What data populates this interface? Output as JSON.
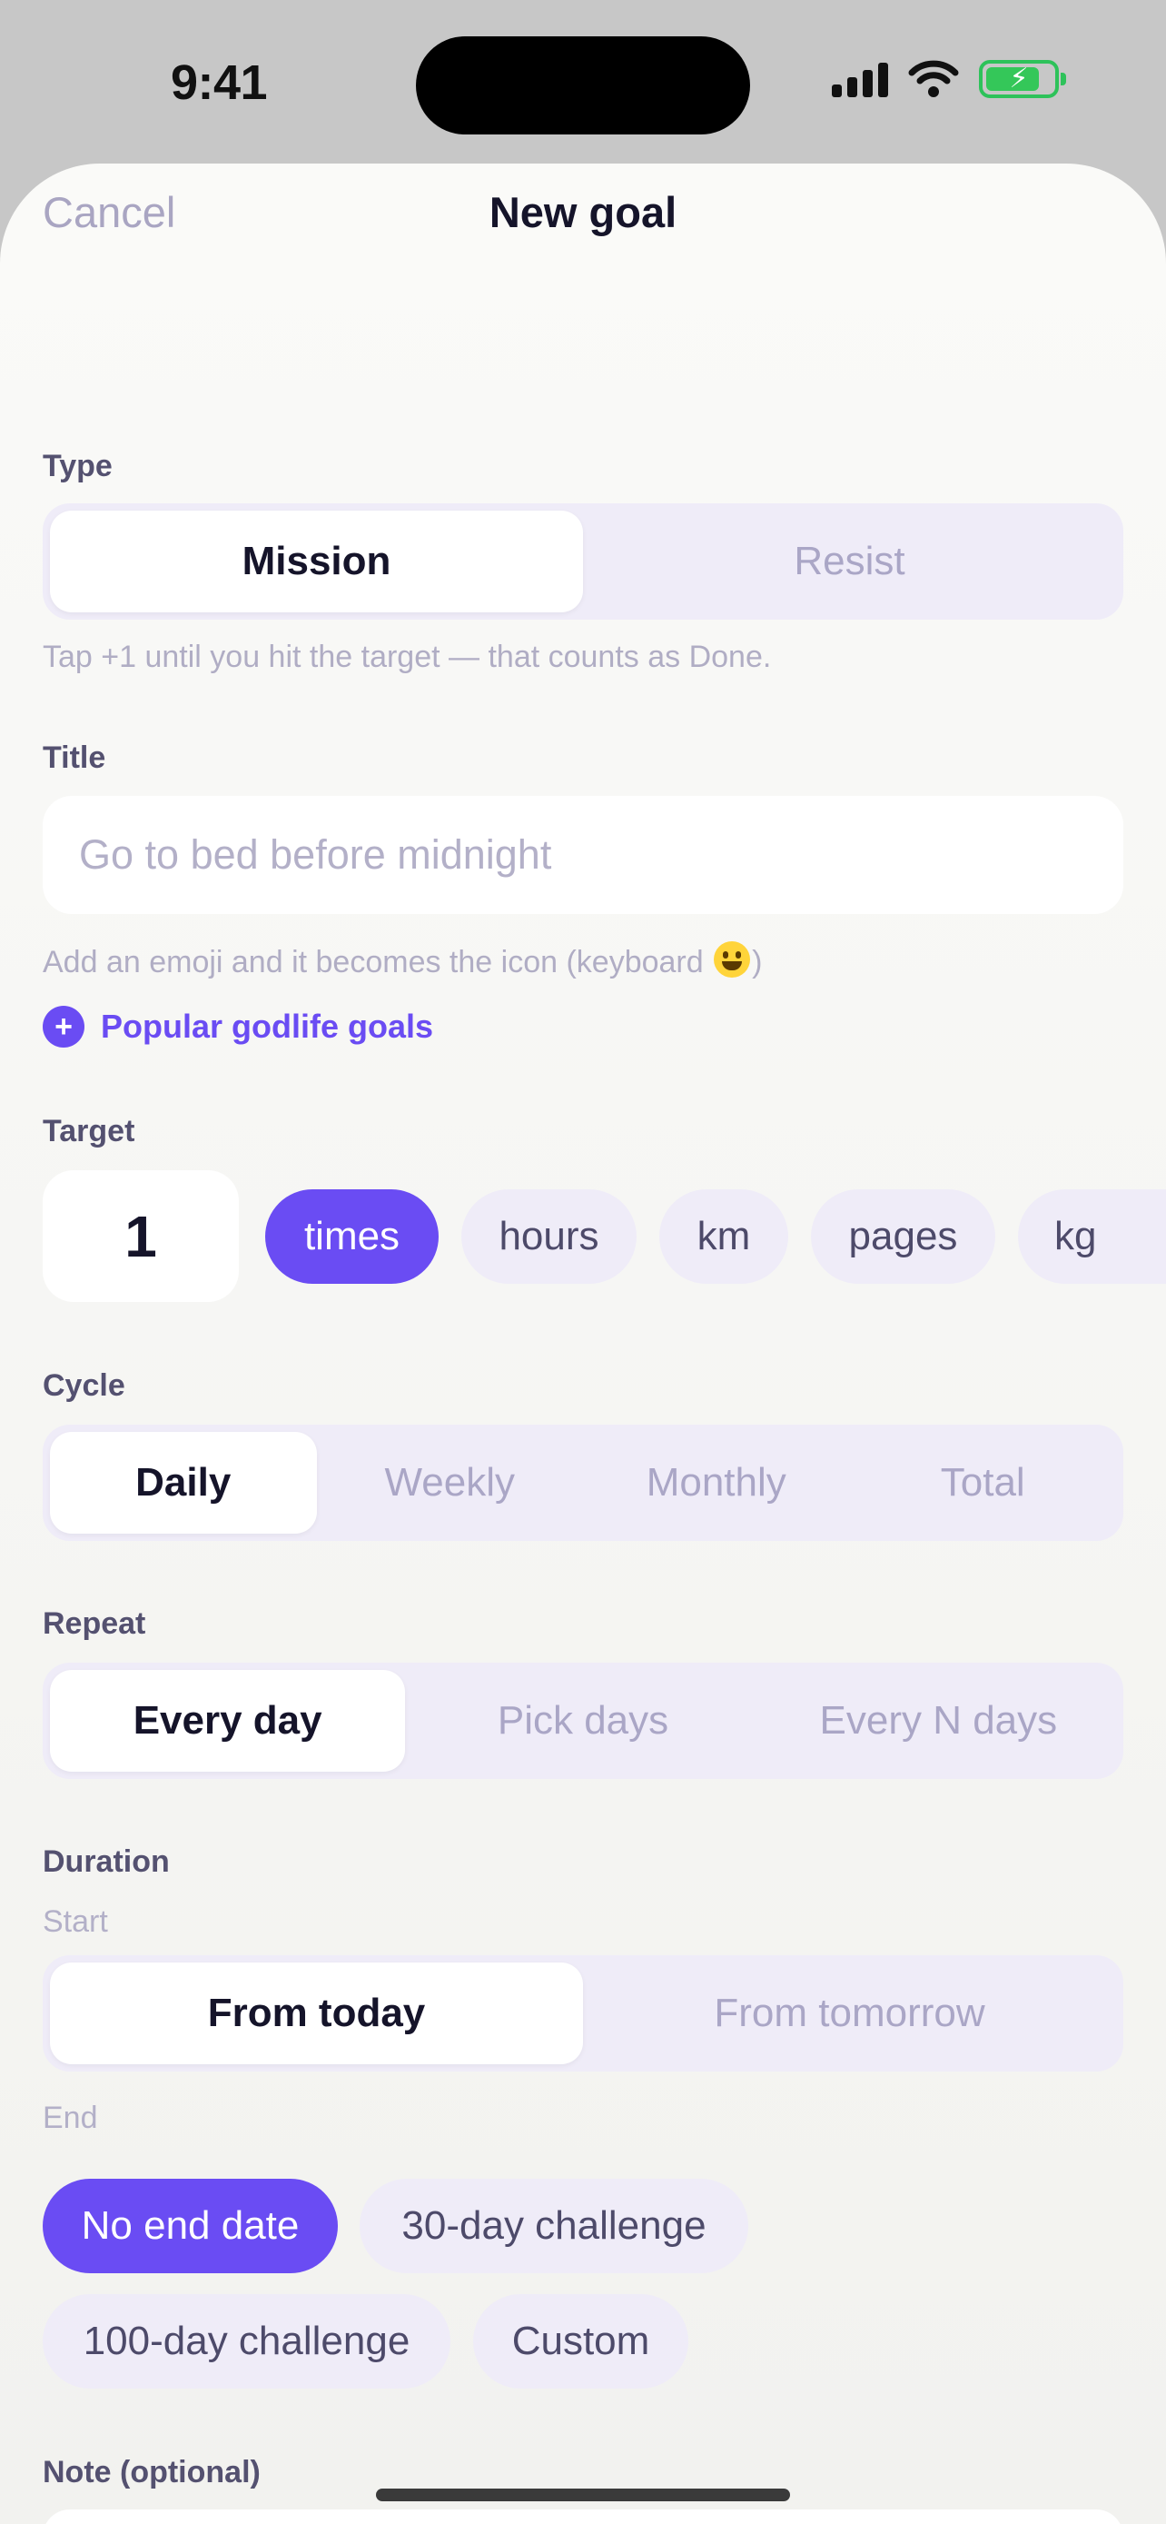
{
  "status_bar": {
    "time": "9:41"
  },
  "header": {
    "cancel": "Cancel",
    "title": "New goal"
  },
  "type": {
    "label": "Type",
    "options": [
      "Mission",
      "Resist"
    ],
    "selected": "Mission",
    "hint": "Tap +1 until you hit the target — that counts as Done."
  },
  "title_field": {
    "label": "Title",
    "value": "",
    "placeholder": "Go to bed before midnight",
    "hint": "Add an emoji and it becomes the icon (keyboard ",
    "hint_end": ")",
    "popular_link": "Popular godlife goals"
  },
  "target": {
    "label": "Target",
    "value": "1",
    "units": [
      "times",
      "hours",
      "km",
      "pages",
      "kg"
    ],
    "selected_unit": "times"
  },
  "cycle": {
    "label": "Cycle",
    "options": [
      "Daily",
      "Weekly",
      "Monthly",
      "Total"
    ],
    "selected": "Daily"
  },
  "repeat": {
    "label": "Repeat",
    "options": [
      "Every day",
      "Pick days",
      "Every N days"
    ],
    "selected": "Every day"
  },
  "duration": {
    "label": "Duration",
    "start_label": "Start",
    "start_options": [
      "From today",
      "From tomorrow"
    ],
    "start_selected": "From today",
    "end_label": "End",
    "end_options": [
      "No end date",
      "30-day challenge",
      "100-day challenge",
      "Custom"
    ],
    "end_selected": "No end date"
  },
  "note": {
    "label": "Note (optional)"
  },
  "colors": {
    "accent": "#6a4cf3",
    "segment_bg": "#efecf8",
    "battery": "#34c759"
  },
  "icons": [
    "signal-icon",
    "wifi-icon",
    "battery-charging-icon",
    "plus-icon",
    "grinning-emoji-icon"
  ]
}
